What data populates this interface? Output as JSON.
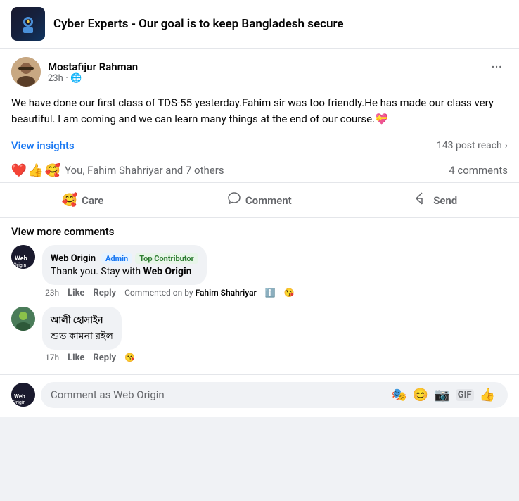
{
  "header": {
    "title": "Cyber Experts - Our goal is to keep Bangladesh secure"
  },
  "post": {
    "author": {
      "name": "Mostafijur Rahman",
      "time": "23h",
      "privacy": "🌐"
    },
    "content": "We have done our first class of TDS-55 yesterday.Fahim sir was too friendly.He has made our class very beautiful. I am coming and we can learn many things at the end of our course.💝",
    "insights_label": "View insights",
    "post_reach": "143 post reach",
    "reactions": {
      "icons": [
        "❤️",
        "👍",
        "🥰"
      ],
      "label": "You, Fahim Shahriyar and 7 others"
    },
    "comments_count": "4 comments",
    "actions": {
      "care_label": "Care",
      "comment_label": "Comment",
      "send_label": "Send"
    }
  },
  "comments": {
    "view_more": "View more comments",
    "items": [
      {
        "author": "Web Origin",
        "badges": [
          "Admin",
          "Top Contributor"
        ],
        "text_plain": "Thank you. Stay with ",
        "text_bold": "Web Origin",
        "time": "23h",
        "like_label": "Like",
        "reply_label": "Reply",
        "commented_by": "Commented on by",
        "commented_author": "Fahim Shahriyar",
        "reaction_emoji": "😘"
      },
      {
        "author": "আলী হোসাইন",
        "text_line1": "শুভ কামনা রইল",
        "time": "17h",
        "like_label": "Like",
        "reply_label": "Reply",
        "reaction_emoji": "😘"
      }
    ],
    "input_placeholder": "Comment as Web Origin",
    "input_icons": [
      "🎭",
      "😊",
      "📷",
      "GIF",
      "👍"
    ]
  }
}
